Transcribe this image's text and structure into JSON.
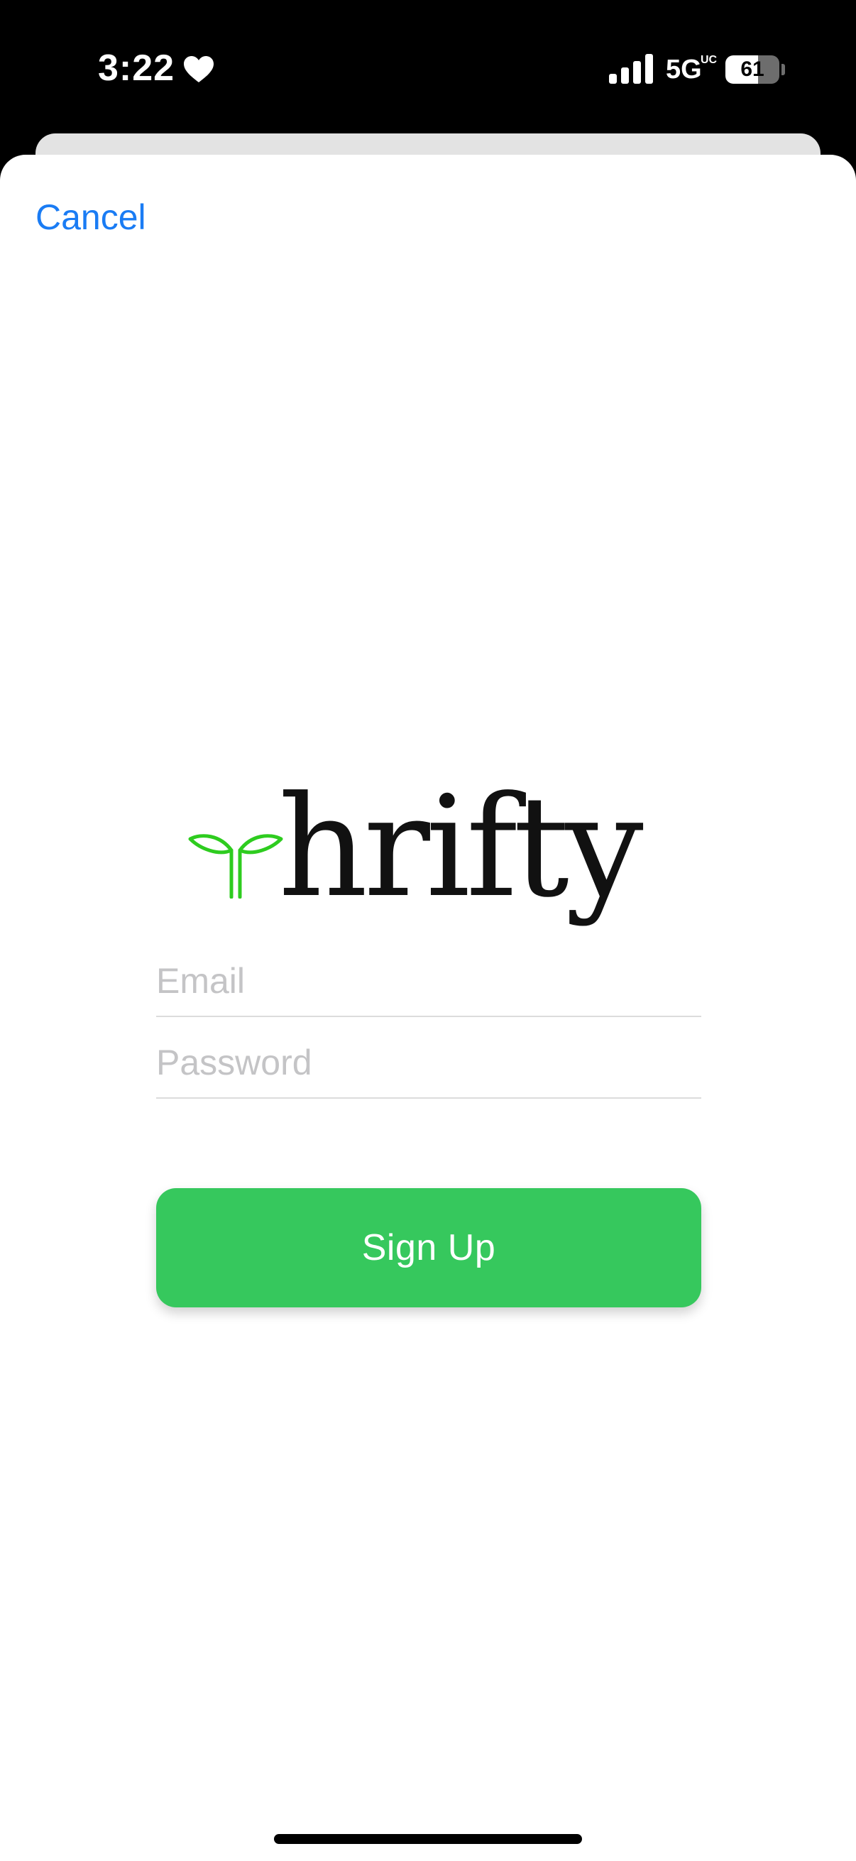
{
  "status_bar": {
    "time": "3:22",
    "heart_icon": "heart-icon",
    "signal_icon": "cellular-signal-icon",
    "network": "5G",
    "network_sub": "UC",
    "battery_level": 61,
    "battery_text": "61"
  },
  "sheet": {
    "cancel_label": "Cancel",
    "logo": {
      "text": "hrifty",
      "sprout_icon": "sprout-icon",
      "sprout_color": "#2ecc1f"
    },
    "form": {
      "email_placeholder": "Email",
      "email_value": "",
      "password_placeholder": "Password",
      "password_value": "",
      "signup_label": "Sign Up"
    }
  },
  "colors": {
    "accent_blue": "#1a7cf4",
    "button_green": "#36c85d",
    "placeholder_gray": "#c4c4c6"
  }
}
